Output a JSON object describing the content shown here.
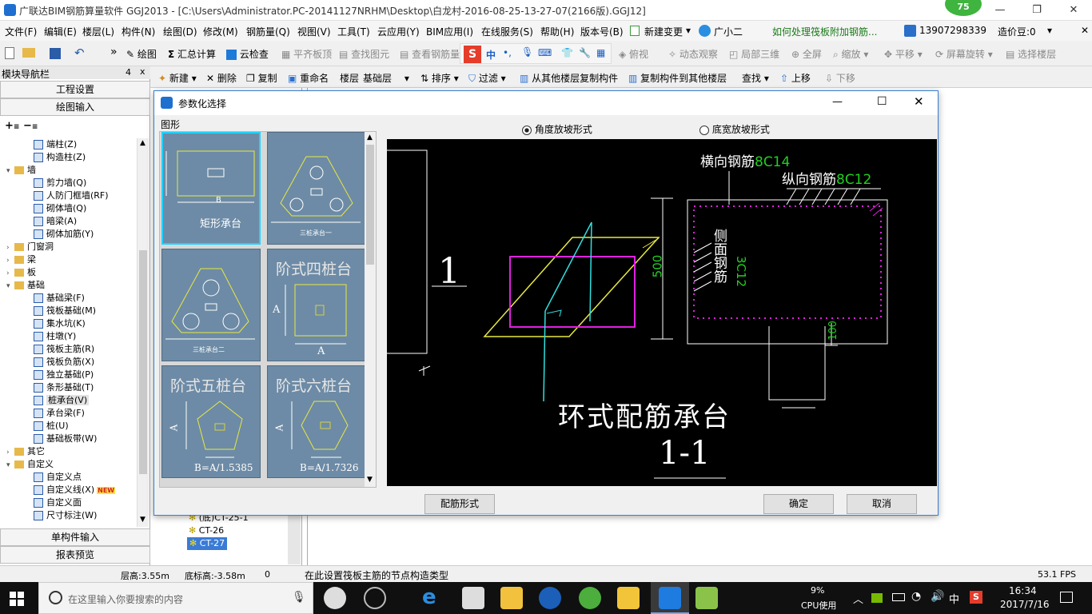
{
  "window": {
    "title": "广联达BIM钢筋算量软件 GGJ2013 - [C:\\Users\\Administrator.PC-20141127NRHM\\Desktop\\白龙村-2016-08-25-13-27-07(2166版).GGJ12]",
    "badge": "75"
  },
  "menu": [
    "文件(F)",
    "编辑(E)",
    "楼层(L)",
    "构件(N)",
    "绘图(D)",
    "修改(M)",
    "钢筋量(Q)",
    "视图(V)",
    "工具(T)",
    "云应用(Y)",
    "BIM应用(I)",
    "在线服务(S)",
    "帮助(H)",
    "版本号(B)",
    "新建变更",
    "广小二"
  ],
  "menu_right": {
    "help_link": "如何处理筏板附加钢筋...",
    "phone": "13907298339",
    "price": "造价豆:0"
  },
  "toolbar1": [
    "绘图",
    "汇总计算",
    "云检查",
    "平齐板顶",
    "查找图元",
    "查看钢筋量",
    "中",
    "俯视",
    "动态观察",
    "局部三维",
    "全屏",
    "缩放",
    "平移",
    "屏幕旋转",
    "选择楼层"
  ],
  "toolbar2": [
    "新建",
    "删除",
    "复制",
    "重命名",
    "楼层",
    "基础层",
    "排序",
    "过滤",
    "从其他楼层复制构件",
    "复制构件到其他楼层",
    "查找",
    "上移",
    "下移"
  ],
  "nav": {
    "title": "模块导航栏",
    "pin": "4",
    "close": "x",
    "sections": [
      "工程设置",
      "绘图输入",
      "单构件输入",
      "报表预览"
    ],
    "tree": [
      {
        "label": "端柱(Z)",
        "indent": 2
      },
      {
        "label": "构造柱(Z)",
        "indent": 2
      },
      {
        "label": "墙",
        "indent": 1,
        "folder": true
      },
      {
        "label": "剪力墙(Q)",
        "indent": 2
      },
      {
        "label": "人防门框墙(RF)",
        "indent": 2
      },
      {
        "label": "砌体墙(Q)",
        "indent": 2
      },
      {
        "label": "暗梁(A)",
        "indent": 2
      },
      {
        "label": "砌体加筋(Y)",
        "indent": 2
      },
      {
        "label": "门窗洞",
        "indent": 1,
        "folder": true
      },
      {
        "label": "梁",
        "indent": 1,
        "folder": true
      },
      {
        "label": "板",
        "indent": 1,
        "folder": true
      },
      {
        "label": "基础",
        "indent": 1,
        "folder": true
      },
      {
        "label": "基础梁(F)",
        "indent": 2
      },
      {
        "label": "筏板基础(M)",
        "indent": 2
      },
      {
        "label": "集水坑(K)",
        "indent": 2
      },
      {
        "label": "柱墩(Y)",
        "indent": 2
      },
      {
        "label": "筏板主筋(R)",
        "indent": 2
      },
      {
        "label": "筏板负筋(X)",
        "indent": 2
      },
      {
        "label": "独立基础(P)",
        "indent": 2
      },
      {
        "label": "条形基础(T)",
        "indent": 2
      },
      {
        "label": "桩承台(V)",
        "indent": 2,
        "selected": true
      },
      {
        "label": "承台梁(F)",
        "indent": 2
      },
      {
        "label": "桩(U)",
        "indent": 2
      },
      {
        "label": "基础板带(W)",
        "indent": 2
      },
      {
        "label": "其它",
        "indent": 1,
        "folder": true
      },
      {
        "label": "自定义",
        "indent": 1,
        "folder": true
      },
      {
        "label": "自定义点",
        "indent": 2
      },
      {
        "label": "自定义线(X)",
        "indent": 2
      },
      {
        "label": "自定义面",
        "indent": 2
      },
      {
        "label": "尺寸标注(W)",
        "indent": 2
      }
    ],
    "new_badge": "NEW"
  },
  "component_list": [
    "(底)CT-25-1",
    "CT-26",
    "CT-27"
  ],
  "dialog": {
    "title": "参数化选择",
    "shapes_label": "图形",
    "radio1": "角度放坡形式",
    "radio2": "底宽放坡形式",
    "thumbs": [
      {
        "caption": "矩形承台",
        "sub": "B"
      },
      {
        "caption": "三桩承台一",
        "sub": ""
      },
      {
        "caption": "三桩承台二",
        "sub": ""
      },
      {
        "caption": "阶式四桩台",
        "sub": "A"
      },
      {
        "caption": "阶式五桩台",
        "sub": "B=A/1.5385"
      },
      {
        "caption": "阶式六桩台",
        "sub": "B=A/1.7326"
      }
    ],
    "preview": {
      "heng": "横向钢筋",
      "heng_val": "8C14",
      "zong": "纵向钢筋",
      "zong_val": "8C12",
      "side": "侧面钢筋",
      "side_val": "3C12",
      "dim500": "500",
      "dim100": "100",
      "label1": "1",
      "title": "环式配筋承台",
      "section": "1-1"
    },
    "btn_form": "配筋形式",
    "btn_ok": "确定",
    "btn_cancel": "取消"
  },
  "status": {
    "floor_h": "层高:3.55m",
    "bottom_h": "底标高:-3.58m",
    "zero": "0",
    "hint": "在此设置筏板主筋的节点构造类型",
    "fps": "53.1 FPS"
  },
  "taskbar": {
    "search": "在这里输入你要搜索的内容",
    "cpu": "9%",
    "cpu_label": "CPU使用",
    "ime": "中",
    "time": "16:34",
    "date": "2017/7/16"
  },
  "colors": {
    "accent": "#1c6fd1",
    "thumb_bg": "#6d8ba6",
    "magenta": "#e020e0",
    "yellow": "#e8e840",
    "cyan": "#30e0e0",
    "green": "#20d020"
  }
}
